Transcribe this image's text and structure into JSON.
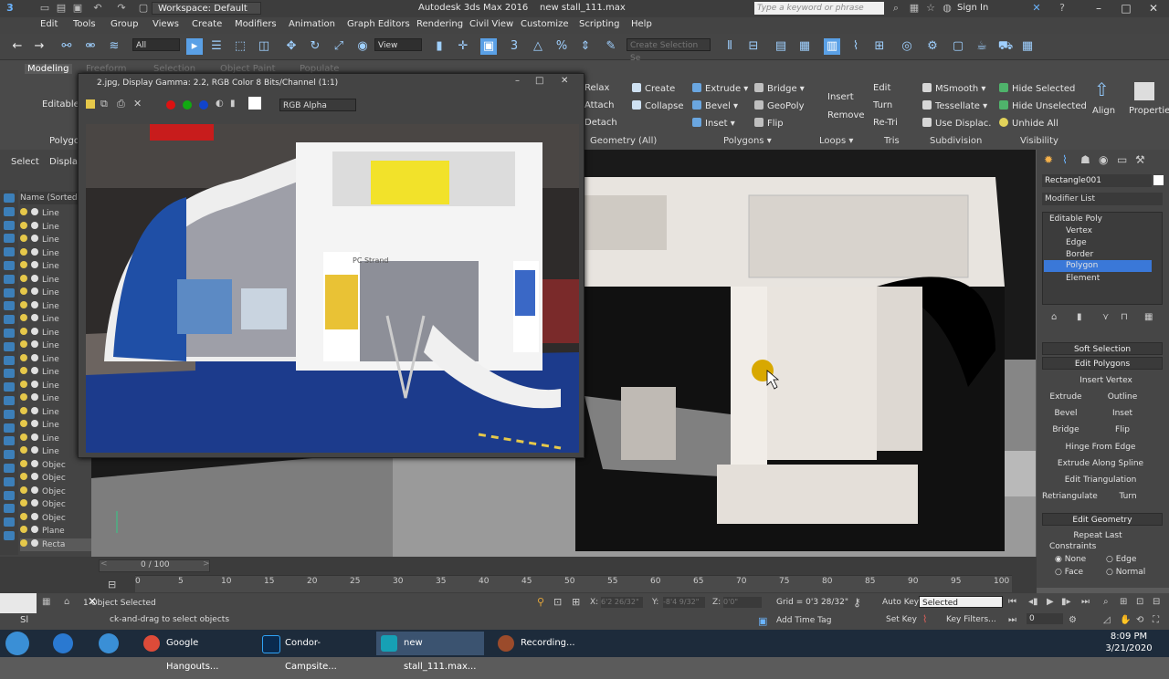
{
  "app": {
    "workspace": "Workspace: Default",
    "title_app": "Autodesk 3ds Max 2016",
    "title_file": "new stall_111.max",
    "search_placeholder": "Type a keyword or phrase",
    "sign_in": "Sign In"
  },
  "menu": [
    "Edit",
    "Tools",
    "Group",
    "Views",
    "Create",
    "Modifiers",
    "Animation",
    "Graph Editors",
    "Rendering",
    "Civil View",
    "Customize",
    "Scripting",
    "Help"
  ],
  "toolbar": {
    "selection_filter": "All",
    "ref_coord": "View",
    "named_selection": "Create Selection Se"
  },
  "ribbon": {
    "tabs": [
      "Modeling",
      "Freeform",
      "Selection",
      "Object Paint",
      "Populate"
    ],
    "editable_label": "Editable",
    "polygon_label": "Polygo",
    "geometry_all": "Geometry (All)",
    "attach": "Attach",
    "detach": "Detach",
    "relax": "Relax",
    "create": "Create",
    "collapse": "Collapse",
    "polygons": {
      "extrude": "Extrude",
      "bevel": "Bevel",
      "inset": "Inset",
      "bridge": "Bridge",
      "geopoly": "GeoPoly",
      "flip": "Flip",
      "group": "Polygons"
    },
    "loops": {
      "insert": "Insert",
      "remove": "Remove",
      "group": "Loops"
    },
    "tris": {
      "edit": "Edit",
      "turn": "Turn",
      "retri": "Re-Tri",
      "group": "Tris"
    },
    "subdivision": {
      "msmooth": "MSmooth",
      "tessellate": "Tessellate",
      "use_displac": "Use Displac.",
      "group": "Subdivision"
    },
    "visibility": {
      "hide_selected": "Hide Selected",
      "hide_unselected": "Hide Unselected",
      "unhide_all": "Unhide All",
      "group": "Visibility"
    },
    "align": "Align",
    "properties": "Properties"
  },
  "left_panel": {
    "select": "Select",
    "display": "Displa",
    "list_header": "Name (Sorted A",
    "items": [
      "Line",
      "Line",
      "Line",
      "Line",
      "Line",
      "Line",
      "Line",
      "Line",
      "Line",
      "Line",
      "Line",
      "Line",
      "Line",
      "Line",
      "Line",
      "Line",
      "Line",
      "Line",
      "Line",
      "Objec",
      "Objec",
      "Objec",
      "Objec",
      "Objec",
      "Plane",
      "Recta"
    ]
  },
  "image_window": {
    "title": "2.jpg, Display Gamma: 2.2, RGB Color 8 Bits/Channel (1:1)",
    "channel": "RGB Alpha",
    "sign_text": "PC Strand"
  },
  "command_panel": {
    "object_name": "Rectangle001",
    "modifier_list": "Modifier List",
    "stack": [
      "Editable Poly",
      "Vertex",
      "Edge",
      "Border",
      "Polygon",
      "Element"
    ],
    "selected_stack": "Polygon",
    "soft_selection": "Soft Selection",
    "edit_polygons": "Edit Polygons",
    "insert_vertex": "Insert Vertex",
    "extrude": "Extrude",
    "outline": "Outline",
    "bevel": "Bevel",
    "inset": "Inset",
    "bridge": "Bridge",
    "flip": "Flip",
    "hinge": "Hinge From Edge",
    "extrude_spline": "Extrude Along Spline",
    "edit_triangulation": "Edit Triangulation",
    "retriangulate": "Retriangulate",
    "turn": "Turn",
    "edit_geometry": "Edit Geometry",
    "repeat_last": "Repeat Last",
    "constraints": "Constraints",
    "c_none": "None",
    "c_edge": "Edge",
    "c_face": "Face",
    "c_normal": "Normal"
  },
  "timeline": {
    "frame": "0 / 100",
    "ticks": [
      "0",
      "5",
      "10",
      "15",
      "20",
      "25",
      "30",
      "35",
      "40",
      "45",
      "50",
      "55",
      "60",
      "65",
      "70",
      "75",
      "80",
      "85",
      "90",
      "95",
      "100"
    ]
  },
  "status": {
    "selected": "1 Object Selected",
    "prompt": "ck-and-drag to select objects",
    "x": "6'2 26/32\"",
    "y": "-8'4 9/32\"",
    "z": "0'0\"",
    "grid": "Grid = 0'3 28/32\"",
    "add_time_tag": "Add Time Tag",
    "auto_key": "Auto Key",
    "set_key": "Set Key",
    "selected_dd": "Selected",
    "key_filters": "Key Filters...",
    "frame_field": "0",
    "script_label": "Sl"
  },
  "taskbar": {
    "items": [
      "Google Hangouts...",
      "Condor-Campsite...",
      "new stall_111.max...",
      "Recording..."
    ],
    "time": "8:09 PM",
    "date": "3/21/2020"
  }
}
